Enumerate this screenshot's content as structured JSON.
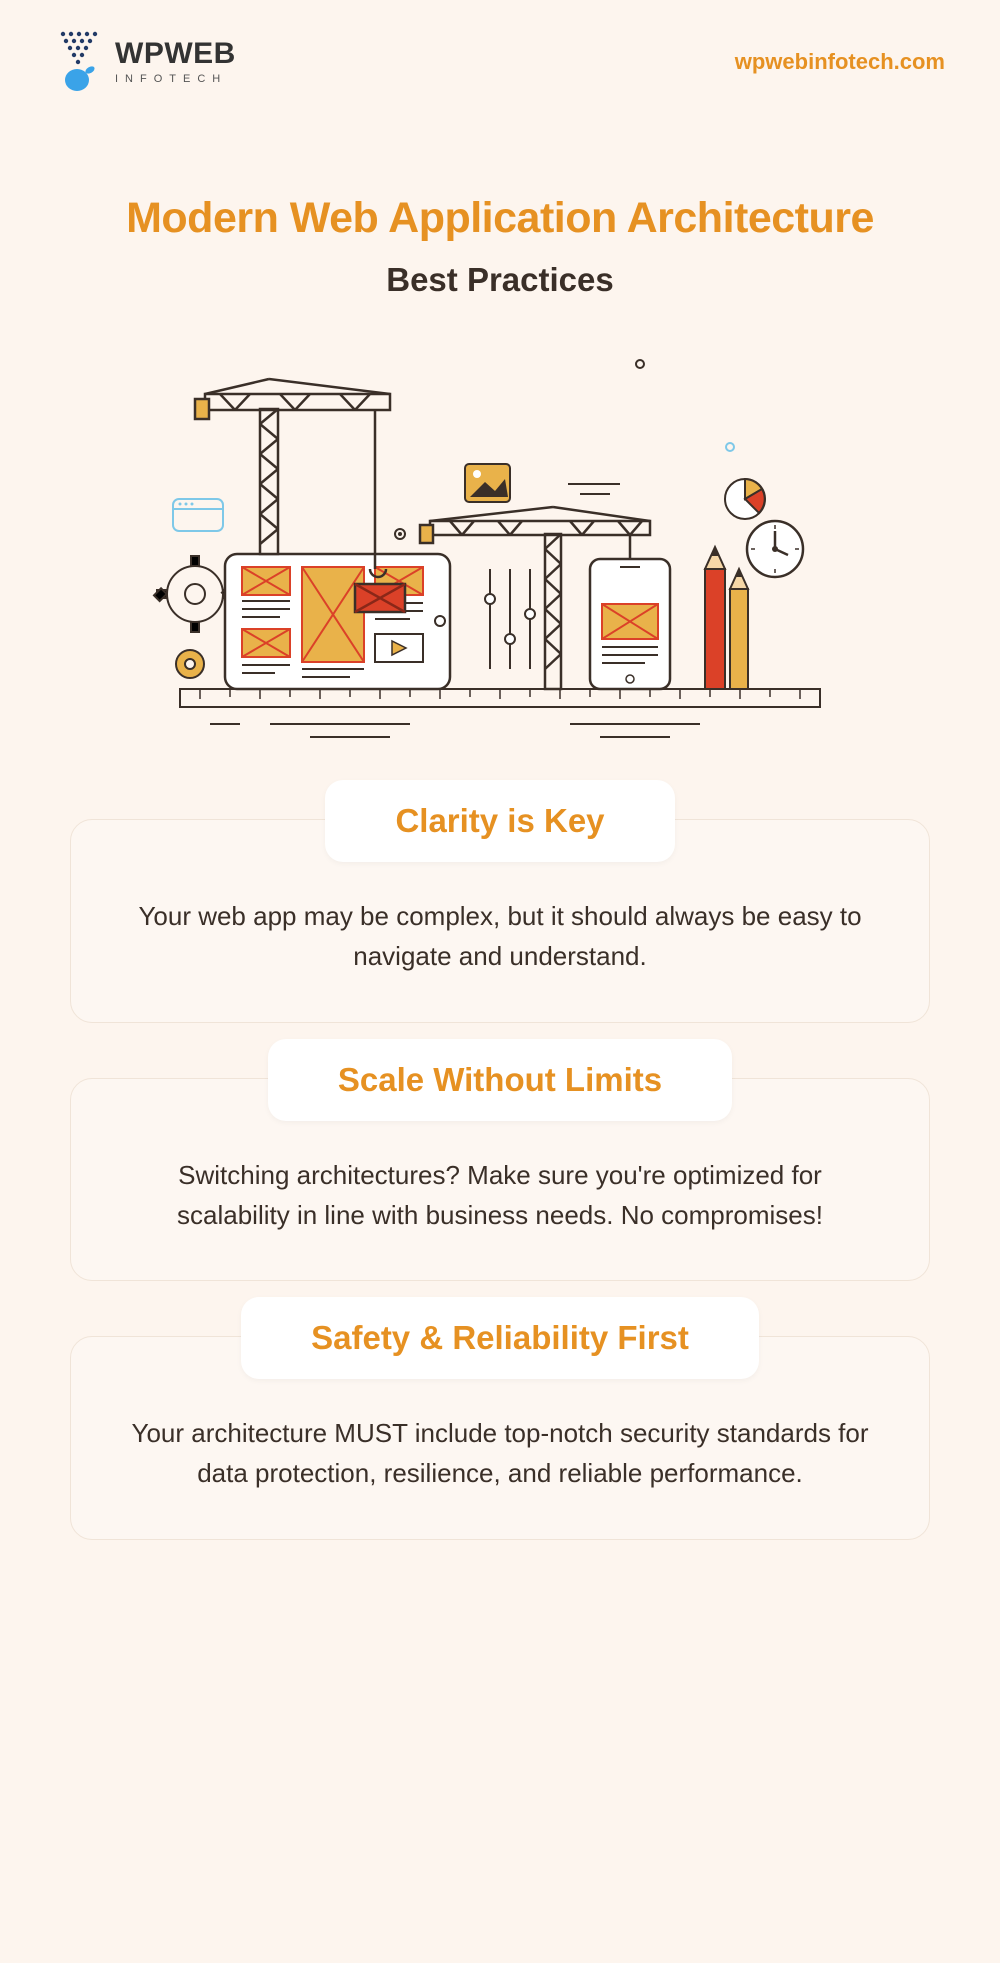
{
  "header": {
    "logo_main": "WPWEB",
    "logo_sub": "INFOTECH",
    "site_url": "wpwebinfotech.com"
  },
  "hero": {
    "title": "Modern Web Application Architecture",
    "subtitle": "Best Practices"
  },
  "cards": [
    {
      "title": "Clarity is Key",
      "body": "Your web app may be complex, but it should always be easy to navigate and understand."
    },
    {
      "title": "Scale Without Limits",
      "body": "Switching architectures? Make sure you're optimized for scalability in line with business needs. No compromises!"
    },
    {
      "title": "Safety & Reliability First",
      "body": "Your architecture MUST include top-notch security standards for data protection, resilience, and reliable performance."
    }
  ]
}
